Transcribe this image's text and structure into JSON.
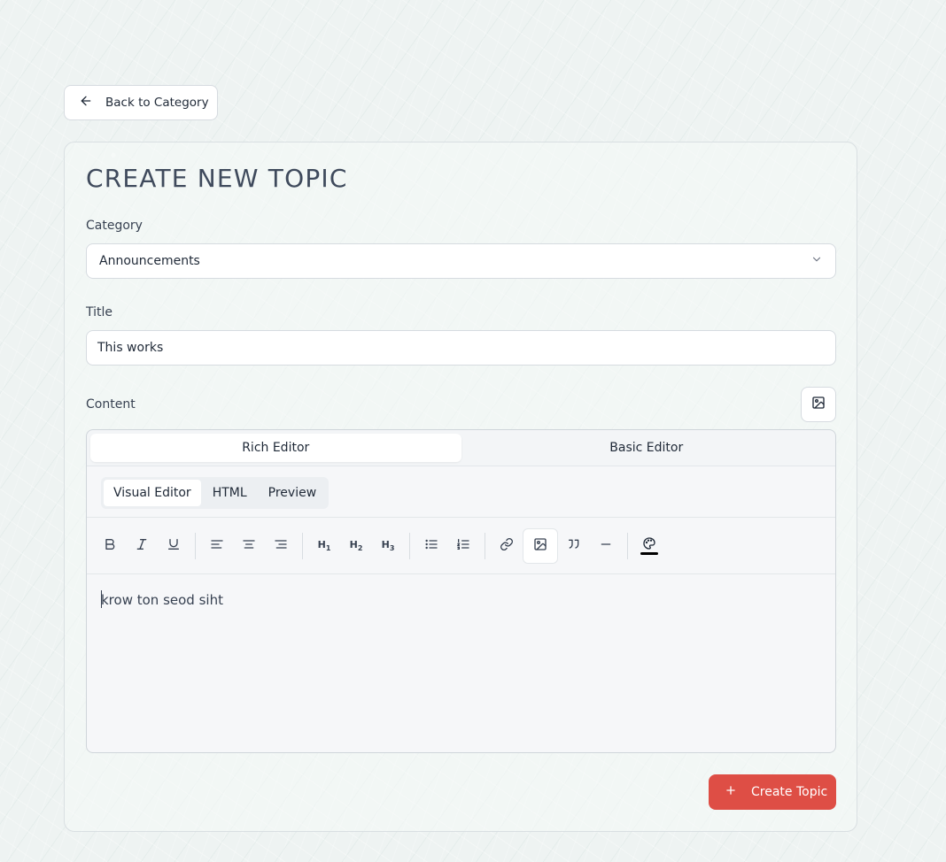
{
  "back_button": {
    "label": "Back to Category",
    "icon": "arrow-left-icon"
  },
  "form": {
    "title": "CREATE NEW TOPIC",
    "category": {
      "label": "Category",
      "value": "Announcements",
      "icon": "chevron-down-icon"
    },
    "title_field": {
      "label": "Title",
      "value": "This works"
    },
    "content": {
      "label": "Content",
      "insert_image_icon": "image-icon"
    }
  },
  "editor": {
    "mode_tabs": [
      {
        "label": "Rich Editor",
        "active": true
      },
      {
        "label": "Basic Editor",
        "active": false
      }
    ],
    "view_tabs": [
      {
        "label": "Visual Editor",
        "active": true
      },
      {
        "label": "HTML",
        "active": false
      },
      {
        "label": "Preview",
        "active": false
      }
    ],
    "toolbar": [
      "bold-icon",
      "italic-icon",
      "underline-icon",
      "align-left-icon",
      "align-center-icon",
      "align-right-icon",
      "heading-1-icon",
      "heading-2-icon",
      "heading-3-icon",
      "bullet-list-icon",
      "numbered-list-icon",
      "link-icon",
      "image-icon",
      "quote-icon",
      "horizontal-rule-icon",
      "palette-icon"
    ],
    "heading_labels": {
      "h1": "H",
      "h1_sub": "1",
      "h2": "H",
      "h2_sub": "2",
      "h3": "H",
      "h3_sub": "3"
    },
    "text": "krow ton seod siht"
  },
  "submit": {
    "label": "Create Topic",
    "icon": "plus-icon"
  },
  "colors": {
    "accent": "#de4e45",
    "text": "#1f2937",
    "title": "#3f4a5c"
  }
}
